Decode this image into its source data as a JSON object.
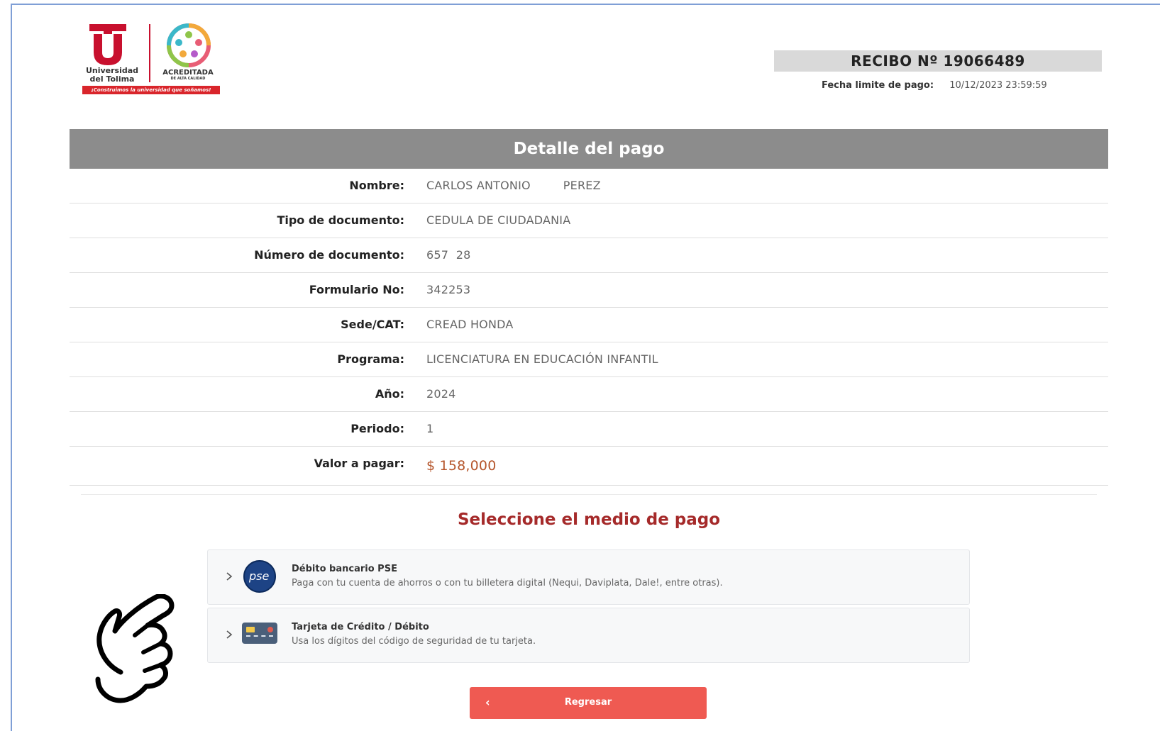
{
  "logo": {
    "university_name": "Universidad del Tolima",
    "accreditation": "ACREDITADA",
    "accreditation_sub": "DE ALTA CALIDAD",
    "slogan": "¡Construimos la universidad que soñamos!",
    "brand_color": "#c8102e"
  },
  "receipt": {
    "title": "RECIBO Nº  19066489",
    "deadline_label": "Fecha limite de pago:",
    "deadline_value": "10/12/2023 23:59:59"
  },
  "detail": {
    "header": "Detalle del pago",
    "rows": [
      {
        "label": "Nombre:",
        "value_a": "CARLOS ANTONIO",
        "value_b": "PEREZ"
      },
      {
        "label": "Tipo de documento:",
        "value": "CEDULA DE CIUDADANIA"
      },
      {
        "label": "Número de documento:",
        "value": "657  28"
      },
      {
        "label": "Formulario No:",
        "value": "342253"
      },
      {
        "label": "Sede/CAT:",
        "value": "CREAD HONDA"
      },
      {
        "label": "Programa:",
        "value": "LICENCIATURA EN EDUCACIÓN INFANTIL"
      },
      {
        "label": "Año:",
        "value": "2024"
      },
      {
        "label": "Periodo:",
        "value": "1"
      },
      {
        "label": "Valor a pagar:",
        "value": "$ 158,000"
      }
    ]
  },
  "payment": {
    "section_title": "Seleccione el medio de pago",
    "options": [
      {
        "title": "Débito bancario PSE",
        "description": "Paga con tu cuenta de ahorros o con tu billetera digital (Nequi, Daviplata, Dale!, entre otras).",
        "icon": "pse-logo-icon",
        "logo_text": "pse"
      },
      {
        "title": "Tarjeta de Crédito / Débito",
        "description": "Usa los dígitos del código de seguridad de tu tarjeta.",
        "icon": "credit-card-icon"
      }
    ]
  },
  "actions": {
    "back_label": "Regresar",
    "back_arrow": "‹",
    "back_color": "#ef5a52"
  },
  "colors": {
    "header_bg": "#8c8c8c",
    "title_red": "#a52a2a",
    "price": "#b5552b"
  }
}
